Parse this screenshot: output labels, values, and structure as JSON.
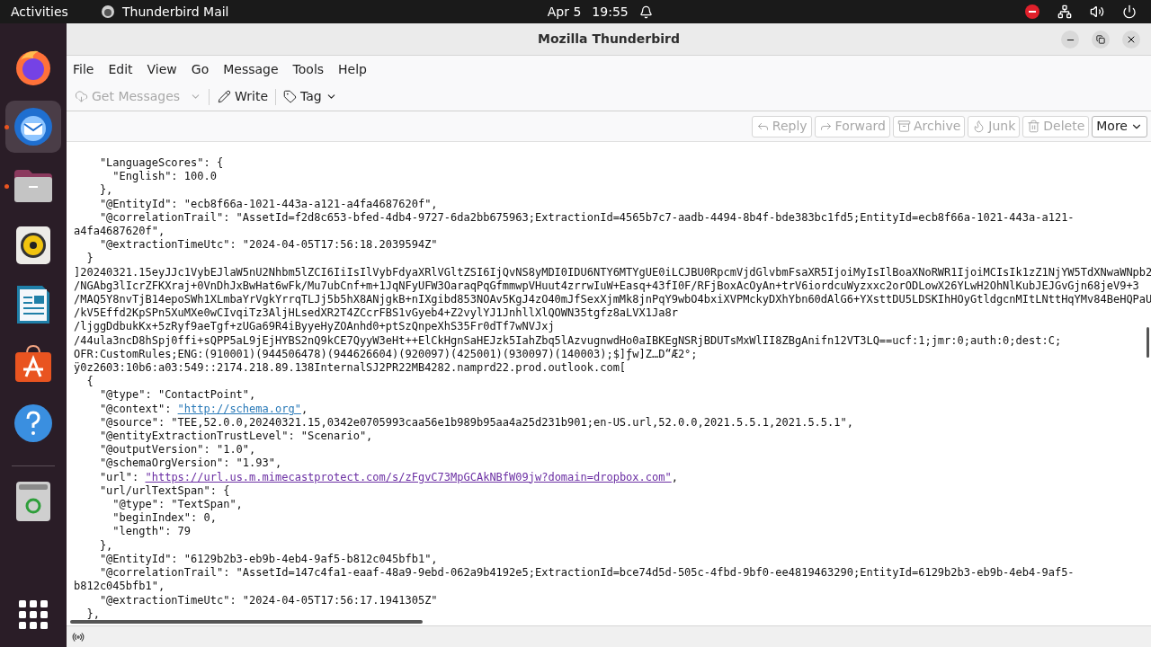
{
  "top_bar": {
    "activities": "Activities",
    "app_name": "Thunderbird Mail",
    "date": "Apr 5",
    "time": "19:55"
  },
  "dock": {
    "items": [
      {
        "kind": "firefox",
        "running": false,
        "selected": false
      },
      {
        "kind": "thunderbird",
        "running": true,
        "selected": true
      },
      {
        "kind": "files",
        "running": true,
        "selected": false
      },
      {
        "kind": "rhythmbox",
        "running": false,
        "selected": false
      },
      {
        "kind": "writer",
        "running": false,
        "selected": false
      },
      {
        "kind": "appcenter",
        "running": false,
        "selected": false
      },
      {
        "kind": "help",
        "running": false,
        "selected": false
      },
      {
        "kind": "trash",
        "running": false,
        "selected": false
      }
    ]
  },
  "window": {
    "title": "Mozilla Thunderbird",
    "menu": [
      "File",
      "Edit",
      "View",
      "Go",
      "Message",
      "Tools",
      "Help"
    ],
    "toolbar": [
      {
        "kind": "get",
        "label": "Get Messages",
        "disabled": true
      },
      {
        "kind": "write",
        "label": "Write",
        "disabled": false
      },
      {
        "kind": "tag",
        "label": "Tag",
        "disabled": false
      }
    ],
    "header_buttons": [
      {
        "kind": "reply",
        "label": "Reply",
        "disabled": true
      },
      {
        "kind": "forward",
        "label": "Forward",
        "disabled": true
      },
      {
        "kind": "archive",
        "label": "Archive",
        "disabled": true
      },
      {
        "kind": "junk",
        "label": "Junk",
        "disabled": true
      },
      {
        "kind": "delete",
        "label": "Delete",
        "disabled": true
      },
      {
        "kind": "more",
        "label": "More",
        "disabled": false
      }
    ],
    "body_lines": [
      {
        "text": "    \"LanguageScores\": {"
      },
      {
        "text": "      \"English\": 100.0"
      },
      {
        "text": "    },"
      },
      {
        "text": "    \"@EntityId\": \"ecb8f66a-1021-443a-a121-a4fa4687620f\","
      },
      {
        "text": "    \"@correlationTrail\": \"AssetId=f2d8c653-bfed-4db4-9727-6da2bb675963;ExtractionId=4565b7c7-aadb-4494-8b4f-bde383bc1fd5;EntityId=ecb8f66a-1021-443a-a121-"
      },
      {
        "text": "a4fa4687620f\","
      },
      {
        "text": "    \"@extractionTimeUtc\": \"2024-04-05T17:56:18.2039594Z\""
      },
      {
        "text": "  }"
      },
      {
        "text": "]20240321.15eyJJc1VybEJlaW5nU2Nhbm5lZCI6IiIsIlVybFdyaXRlVGltZSI6IjQvNS8yMDI0IDU6NTY6MTYgUE0iLCJBU0RpcmVjdGlvbmFsaXR5IjoiMyIsIlBoaXNoRWR1IjoiMCIsIk1zZ1NjYW5TdXNwaWNpb2"
      },
      {
        "text": "/NGAbg3lIcrZFKXraj+0VnDhJxBwHat6wFk/Mu7ubCnf+m+1JqNFyUFW3OaraqPqGfmmwpVHuut4zrrwIuW+Easq+43fI0F/RFjBoxAcOyAn+trV6iordcuWyzxxc2orODLowX26YLwH2OhNlKubJEJGvGjn68jeV9+3"
      },
      {
        "text": "/MAQ5Y8nvTjB14epoSWh1XLmbaYrVgkYrrqTLJj5b5hX8ANjgkB+nIXgibd853NOAv5KgJ4zO40mJfSexXjmMk8jnPqY9wbO4bxiXVPMckyDXhYbn60dAlG6+YXsttDU5LDSKIhHOyGtldgcnMItLNttHqYMv84BeHQPaU"
      },
      {
        "text": "/kV5Effd2KpSPn5XuMXe0wCIvqiTz3AljHLsedXR2T4ZCcrFBS1vGyeb4+Z2vylYJ1JnhllXlQOWN35tgfz8aLVX1Ja8r"
      },
      {
        "text": "/ljggDdbukKx+5zRyf9aeTgf+zUGa69R4iByyeHyZOAnhd0+ptSzQnpeXhS35Fr0dTf7wNVJxj"
      },
      {
        "text": "/44ula3ncD8hSpj0ffi+sQPP5aL9jEjHYBS2nQ9kCE7QyyW3eHt++ElCkHgnSaHEJzk5IahZbq5lAzvugnwdHo0aIBKEgNSRjBDUTsMxWlII8ZBgAnifn12VT3LQ==ucf:1;jmr:0;auth:0;dest:C;"
      },
      {
        "text": "OFR:CustomRules;ENG:(910001)(944506478)(944626604)(920097)(425001)(930097)(140003);$]ƒw]Z…D“Æ2°;"
      },
      {
        "text": "ÿ0z2603:10b6:a03:549::2174.218.89.138InternalSJ2PR22MB4282.namprd22.prod.outlook.com["
      },
      {
        "text": "  {"
      },
      {
        "text": "    \"@type\": \"ContactPoint\","
      },
      {
        "text": "    \"@context\": ",
        "link": "\"http://schema.org\"",
        "after": ",",
        "visited": false
      },
      {
        "text": "    \"@source\": \"TEE,52.0.0,20240321.15,0342e0705993caa56e1b989b95aa4a25d231b901;en-US.url,52.0.0,2021.5.5.1,2021.5.5.1\","
      },
      {
        "text": "    \"@entityExtractionTrustLevel\": \"Scenario\","
      },
      {
        "text": "    \"@outputVersion\": \"1.0\","
      },
      {
        "text": "    \"@schemaOrgVersion\": \"1.93\","
      },
      {
        "text": "    \"url\": ",
        "link": "\"https://url.us.m.mimecastprotect.com/s/zFgvC73MpGCAkNBfW09jw?domain=dropbox.com\"",
        "after": ",",
        "visited": true
      },
      {
        "text": "    \"url/urlTextSpan\": {"
      },
      {
        "text": "      \"@type\": \"TextSpan\","
      },
      {
        "text": "      \"beginIndex\": 0,"
      },
      {
        "text": "      \"length\": 79"
      },
      {
        "text": "    },"
      },
      {
        "text": "    \"@EntityId\": \"6129b2b3-eb9b-4eb4-9af5-b812c045bfb1\","
      },
      {
        "text": "    \"@correlationTrail\": \"AssetId=147c4fa1-eaaf-48a9-9ebd-062a9b4192e5;ExtractionId=bce74d5d-505c-4fbd-9bf0-ee4819463290;EntityId=6129b2b3-eb9b-4eb4-9af5-"
      },
      {
        "text": "b812c045bfb1\","
      },
      {
        "text": "    \"@extractionTimeUtc\": \"2024-04-05T17:56:17.1941305Z\""
      },
      {
        "text": "  },"
      }
    ]
  }
}
